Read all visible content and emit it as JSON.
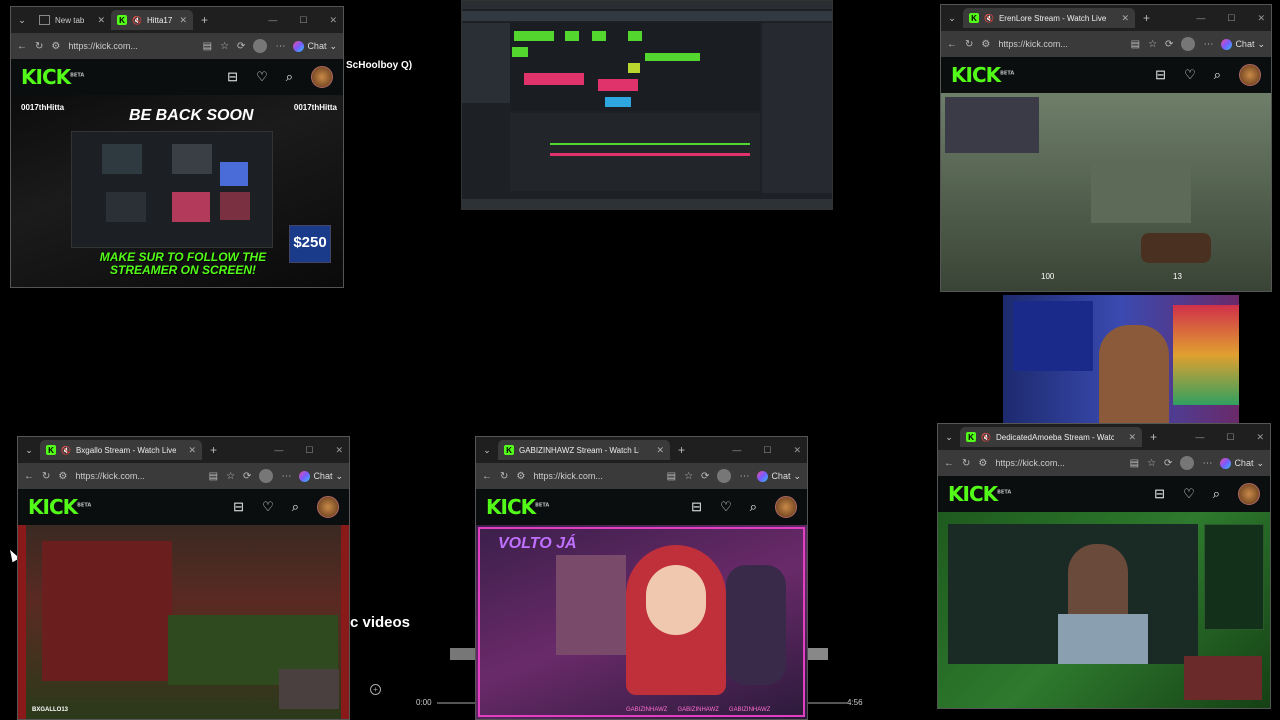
{
  "win1": {
    "tabs": [
      {
        "label": "New tab"
      },
      {
        "label": "Hitta17"
      }
    ],
    "url": "https://kick.com...",
    "chat_label": "Chat",
    "streamer_tag": "0017thHitta",
    "stream_top_text": "BE BACK SOON",
    "stream_bottom_text": "MAKE SUR TO FOLLOW THE STREAMER ON SCREEN!",
    "amount": "$250"
  },
  "win2": {
    "tab": "ErenLore Stream - Watch Live",
    "url": "https://kick.com...",
    "chat_label": "Chat",
    "hud_health": "100",
    "hud_ammo": "13"
  },
  "win3": {
    "tab": "Bxgallo Stream - Watch Live",
    "url": "https://kick.com...",
    "chat_label": "Chat",
    "overlay_name": "BXGALLO13"
  },
  "win4": {
    "tab": "GABIZINHAWZ Stream - Watch Live",
    "url": "https://kick.com...",
    "chat_label": "Chat",
    "overlay_banner": "VOLTO JÁ",
    "watermark": "GABIZINHAWZ"
  },
  "win5": {
    "tab": "DedicatedAmoeba Stream - Watch Live",
    "url": "https://kick.com...",
    "chat_label": "Chat"
  },
  "desktop": {
    "schoolboy_text": "ScHoolboy Q)",
    "videos_text": "c videos",
    "time_start": "0:00",
    "time_end": "4:56"
  },
  "kick": {
    "logo": "KICK",
    "beta": "BETA"
  },
  "colors": {
    "kick_green": "#53fc18",
    "background": "#000000"
  },
  "icons": [
    "back-icon",
    "reload-icon",
    "bookmark-icon",
    "heart-icon",
    "search-icon",
    "refresh-icon",
    "profile-icon",
    "more-icon"
  ]
}
